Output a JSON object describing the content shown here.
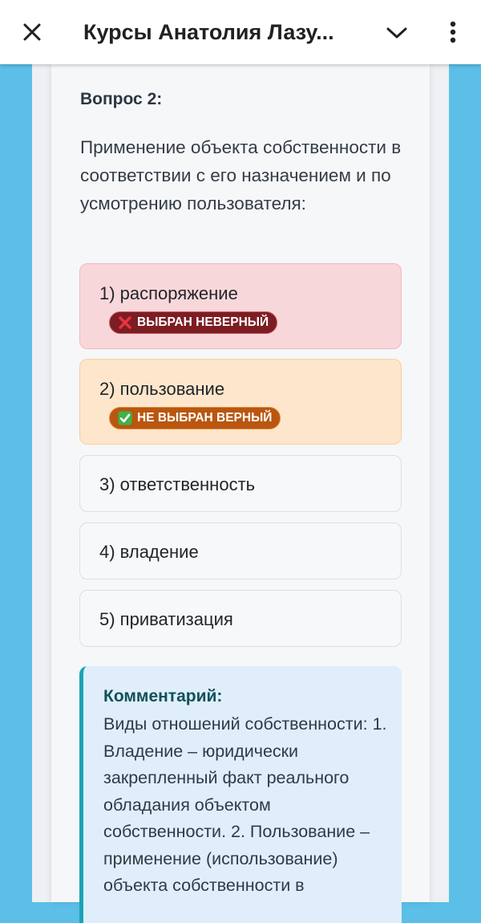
{
  "header": {
    "title": "Курсы Анатолия Лазу..."
  },
  "question": {
    "title": "Вопрос 2:",
    "text": "Применение объекта собственности в соответствии с его назначением и по усмотрению пользователя:"
  },
  "options": [
    {
      "label": "1) распоряжение",
      "status": "wrong",
      "badge": "ВЫБРАН НЕВЕРНЫЙ",
      "badge_icon": "cross-mark-icon"
    },
    {
      "label": "2) пользование",
      "status": "missed",
      "badge": "НЕ ВЫБРАН ВЕРНЫЙ",
      "badge_icon": "check-mark-icon"
    },
    {
      "label": "3) ответственность",
      "status": "neutral"
    },
    {
      "label": "4) владение",
      "status": "neutral"
    },
    {
      "label": "5) приватизация",
      "status": "neutral"
    }
  ],
  "comment": {
    "title": "Комментарий:",
    "text": "Виды отношений собственности: 1. Владение – юридически закрепленный факт реального обладания объектом собственности. 2. Пользование – применение (использование) объекта собственности в"
  },
  "colors": {
    "background": "#5bbfe8",
    "wrong_bg": "#f8d7da",
    "wrong_badge": "#7c1d23",
    "missed_bg": "#fde6cb",
    "missed_badge": "#b9560f",
    "comment_bg": "#dfeefa",
    "comment_accent": "#1aa3b5"
  }
}
